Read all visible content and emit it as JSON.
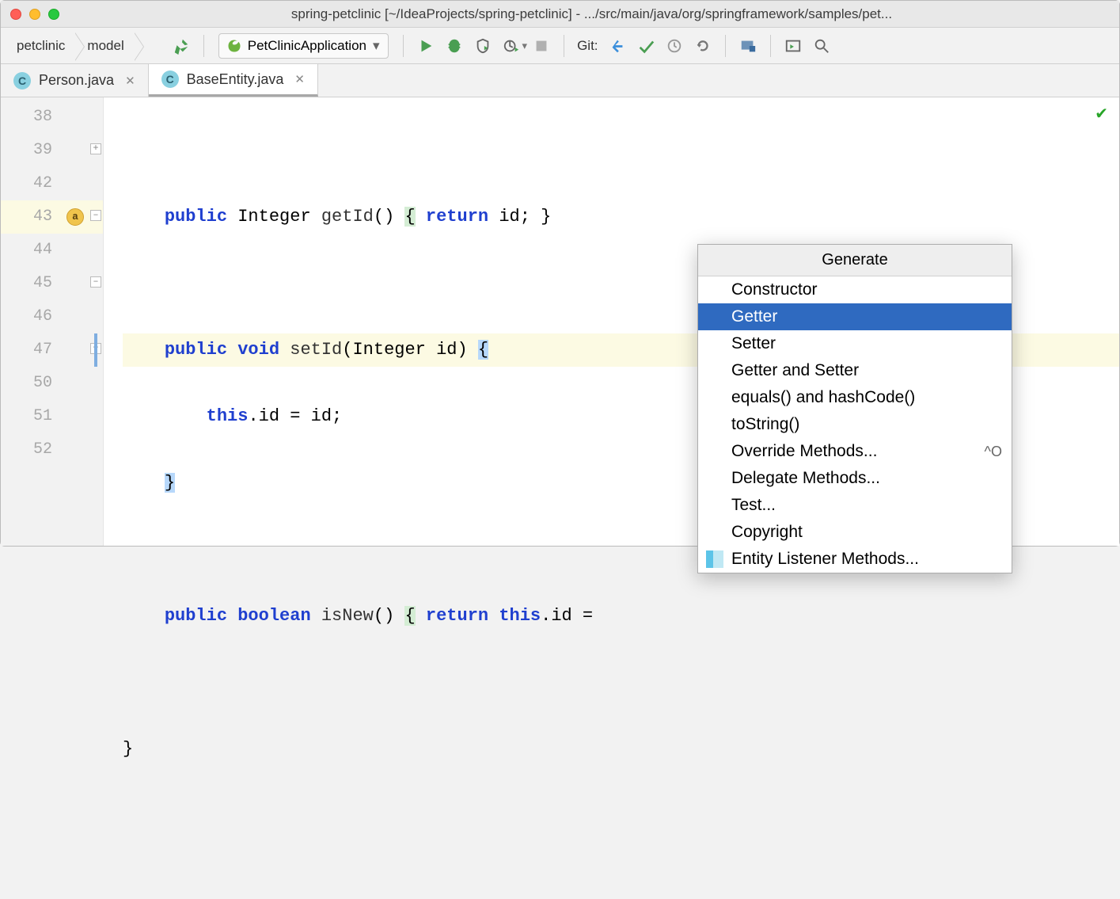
{
  "window": {
    "title": "spring-petclinic [~/IdeaProjects/spring-petclinic] - .../src/main/java/org/springframework/samples/pet..."
  },
  "breadcrumb": [
    "petclinic",
    "model"
  ],
  "run_config": {
    "label": "PetClinicApplication"
  },
  "toolbar": {
    "git_label": "Git:"
  },
  "tabs": [
    {
      "label": "Person.java",
      "active": false
    },
    {
      "label": "BaseEntity.java",
      "active": true
    }
  ],
  "line_numbers": [
    "38",
    "39",
    "42",
    "43",
    "44",
    "45",
    "46",
    "47",
    "50",
    "51",
    "52"
  ],
  "code": {
    "l39": {
      "kw1": "public",
      "type": "Integer",
      "fn": "getId",
      "paren": "()",
      "body_kw": "return",
      "body_id": "id",
      "tail": "; }"
    },
    "l43": {
      "kw1": "public",
      "kw2": "void",
      "fn": "setId",
      "args": "(Integer id)",
      "br": "{"
    },
    "l44": {
      "kw": "this",
      "rest": ".id = id;"
    },
    "l45": {
      "br": "}"
    },
    "l47": {
      "kw1": "public",
      "kw2": "boolean",
      "fn": "isNew",
      "paren": "()",
      "body_kw": "return",
      "body_this": "this",
      "tail": ".id ="
    },
    "l51": {
      "br": "}"
    }
  },
  "popup": {
    "title": "Generate",
    "items": [
      {
        "label": "Constructor"
      },
      {
        "label": "Getter",
        "selected": true
      },
      {
        "label": "Setter"
      },
      {
        "label": "Getter and Setter"
      },
      {
        "label": "equals() and hashCode()"
      },
      {
        "label": "toString()"
      },
      {
        "label": "Override Methods...",
        "shortcut": "^O"
      },
      {
        "label": "Delegate Methods..."
      },
      {
        "label": "Test..."
      },
      {
        "label": "Copyright"
      },
      {
        "label": "Entity Listener Methods...",
        "icon": "entity"
      }
    ]
  }
}
